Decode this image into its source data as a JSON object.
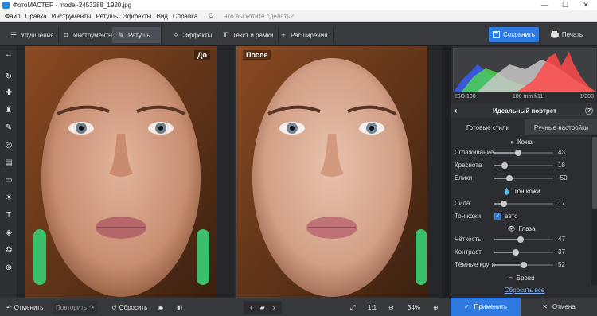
{
  "window": {
    "title": "ФотоМАСТЕР - model-2453288_1920.jpg",
    "minimize": "—",
    "maximize": "☐",
    "close": "✕"
  },
  "menu": {
    "items": [
      "Файл",
      "Правка",
      "Инструменты",
      "Ретушь",
      "Эффекты",
      "Вид",
      "Справка"
    ],
    "search_placeholder": "Что вы хотите сделать?"
  },
  "tabs": [
    {
      "label": "Улучшения",
      "icon": "sliders-icon"
    },
    {
      "label": "Инструменты",
      "icon": "crop-icon"
    },
    {
      "label": "Ретушь",
      "icon": "brush-icon",
      "active": true
    },
    {
      "label": "Эффекты",
      "icon": "magic-wand-icon"
    },
    {
      "label": "Текст и рамки",
      "icon": "text-icon"
    },
    {
      "label": "Расширения",
      "icon": "plus-icon"
    }
  ],
  "actions": {
    "save": "Сохранить",
    "print": "Печать"
  },
  "photos": {
    "before": "До",
    "after": "После"
  },
  "histogram": {
    "iso": "ISO 100",
    "lens": "100 mm f/11",
    "shutter": "1/200"
  },
  "panel": {
    "title": "Идеальный портрет",
    "tabs": [
      "Готовые стили",
      "Ручные настройки"
    ],
    "active_tab": 1,
    "sections": {
      "skin": "Кожа",
      "tone": "Тон кожи",
      "eyes": "Глаза",
      "brows": "Брови"
    },
    "skin_rows": [
      {
        "label": "Сглаживание",
        "value": "43",
        "level": 0.4
      },
      {
        "label": "Краснота",
        "value": "18",
        "level": 0.17
      },
      {
        "label": "Блики",
        "value": "-50",
        "level": 0.25
      }
    ],
    "tone_rows": [
      {
        "label": "Сила",
        "value": "17",
        "level": 0.16
      }
    ],
    "tone_toggle": {
      "label": "Тон кожи",
      "checkbox_label": "авто",
      "checked": true
    },
    "eye_rows": [
      {
        "label": "Чёткость",
        "value": "47",
        "level": 0.45
      },
      {
        "label": "Контраст",
        "value": "37",
        "level": 0.36
      },
      {
        "label": "Тёмные круги",
        "value": "52",
        "level": 0.5
      }
    ],
    "reset_all": "Сбросить все"
  },
  "bottom": {
    "undo": "Отменить",
    "redo": "Повторить",
    "reset": "Сбросить",
    "zoom_fit": "1:1",
    "zoom": "34%",
    "apply": "Применить",
    "cancel": "Отмена"
  }
}
